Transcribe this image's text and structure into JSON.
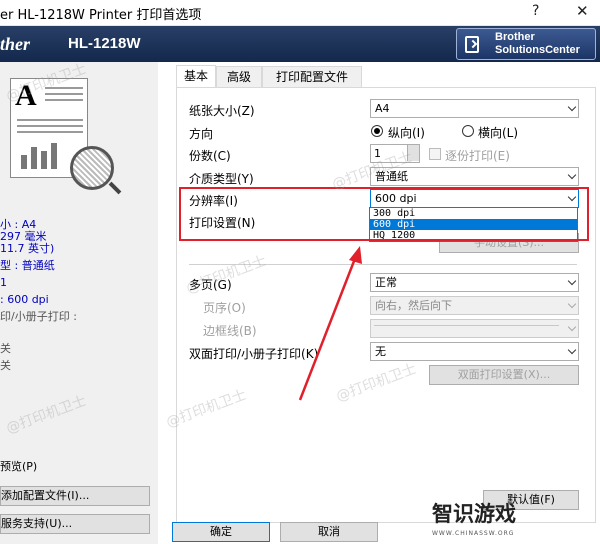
{
  "window": {
    "title": "er HL-1218W Printer 打印首选项",
    "help": "?",
    "close": "✕"
  },
  "banner": {
    "brand": "ther",
    "model": "HL-1218W",
    "solutions_line1": "Brother",
    "solutions_line2": "SolutionsCenter"
  },
  "left": {
    "info": [
      {
        "label": "小 : A4",
        "cls": "v"
      },
      {
        "label": "297 毫米",
        "cls": "v"
      },
      {
        "label": "11.7 英寸)",
        "cls": "v"
      },
      {
        "label": "型 : 普通纸",
        "cls": "v"
      },
      {
        "label": "1",
        "cls": "v"
      },
      {
        "label": ": 600 dpi",
        "cls": "v"
      },
      {
        "label": "印/小册子打印 :",
        "cls": "g"
      },
      {
        "label": "关",
        "cls": "g"
      },
      {
        "label": "关",
        "cls": "g"
      }
    ],
    "preview_label": "预览(P)",
    "add_profile_button": "添加配置文件(I)...",
    "support_button": "服务支持(U)..."
  },
  "tabs": [
    {
      "label": "基本",
      "active": true
    },
    {
      "label": "高级",
      "active": false
    },
    {
      "label": "打印配置文件",
      "active": false
    }
  ],
  "basic": {
    "paper_size_label": "纸张大小(Z)",
    "paper_size_value": "A4",
    "orientation_label": "方向",
    "portrait_label": "纵向(I)",
    "landscape_label": "横向(L)",
    "copies_label": "份数(C)",
    "copies_value": "1",
    "collate_label": "逐份打印(E)",
    "media_label": "介质类型(Y)",
    "media_value": "普通纸",
    "resolution_label": "分辨率(I)",
    "resolution_value": "600 dpi",
    "resolution_options": [
      {
        "label": "300 dpi",
        "selected": false
      },
      {
        "label": "600 dpi",
        "selected": true
      },
      {
        "label": "HQ 1200",
        "selected": false
      }
    ],
    "print_settings_label": "打印设置(N)",
    "manual_settings_button": "手动设置(S)...",
    "multipage_label": "多页(G)",
    "multipage_value": "正常",
    "page_order_label": "页序(O)",
    "page_order_value": "向右，然后向下",
    "border_label": "边框线(B)",
    "duplex_label": "双面打印/小册子打印(K)",
    "duplex_value": "无",
    "duplex_settings_button": "双面打印设置(X)...",
    "default_button": "默认值(F)"
  },
  "footer": {
    "ok_button": "确定",
    "cancel_button": "取消"
  },
  "watermarks": {
    "text": "@打印机卫士",
    "logo_text": "智识游戏",
    "logo_url": "WWW.CHINASSW.ORG"
  },
  "colors": {
    "highlight": "#e0202a",
    "banner": "#1c3566",
    "selection": "#0078d7"
  }
}
